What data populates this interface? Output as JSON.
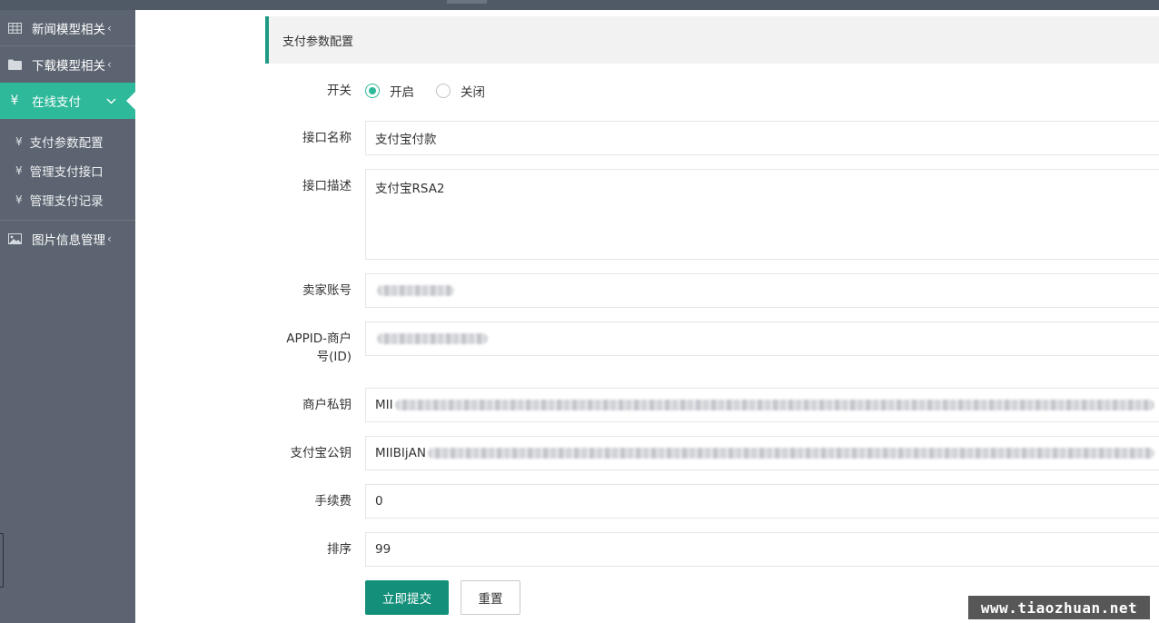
{
  "sidebar": {
    "items": [
      {
        "label": "新闻模型相关",
        "icon": "table-icon",
        "chevron": "‹"
      },
      {
        "label": "下载模型相关",
        "icon": "folder-icon",
        "chevron": "‹"
      },
      {
        "label": "在线支付",
        "icon": "yen-icon",
        "chevron": "⌄"
      },
      {
        "label": "图片信息管理",
        "icon": "image-icon",
        "chevron": "‹"
      }
    ],
    "sub_items": [
      {
        "label": "支付参数配置",
        "icon": "yen-icon"
      },
      {
        "label": "管理支付接口",
        "icon": "yen-icon"
      },
      {
        "label": "管理支付记录",
        "icon": "yen-icon"
      }
    ],
    "accent_color": "#2fb99b"
  },
  "panel": {
    "title": "支付参数配置"
  },
  "form": {
    "switch": {
      "label": "开关",
      "options": [
        "开启",
        "关闭"
      ],
      "selected": "开启"
    },
    "name": {
      "label": "接口名称",
      "value": "支付宝付款"
    },
    "desc": {
      "label": "接口描述",
      "value": "支付宝RSA2"
    },
    "seller": {
      "label": "卖家账号",
      "value": ""
    },
    "appid": {
      "label": "APPID-商户号(ID)",
      "value": ""
    },
    "private_key": {
      "label": "商户私钥",
      "value": "MII"
    },
    "public_key": {
      "label": "支付宝公钥",
      "value": "MIIBIjAN"
    },
    "fee": {
      "label": "手续费",
      "value": "0"
    },
    "sort": {
      "label": "排序",
      "value": "99"
    }
  },
  "buttons": {
    "submit": "立即提交",
    "reset": "重置"
  },
  "watermark": "www.tiaozhuan.net"
}
